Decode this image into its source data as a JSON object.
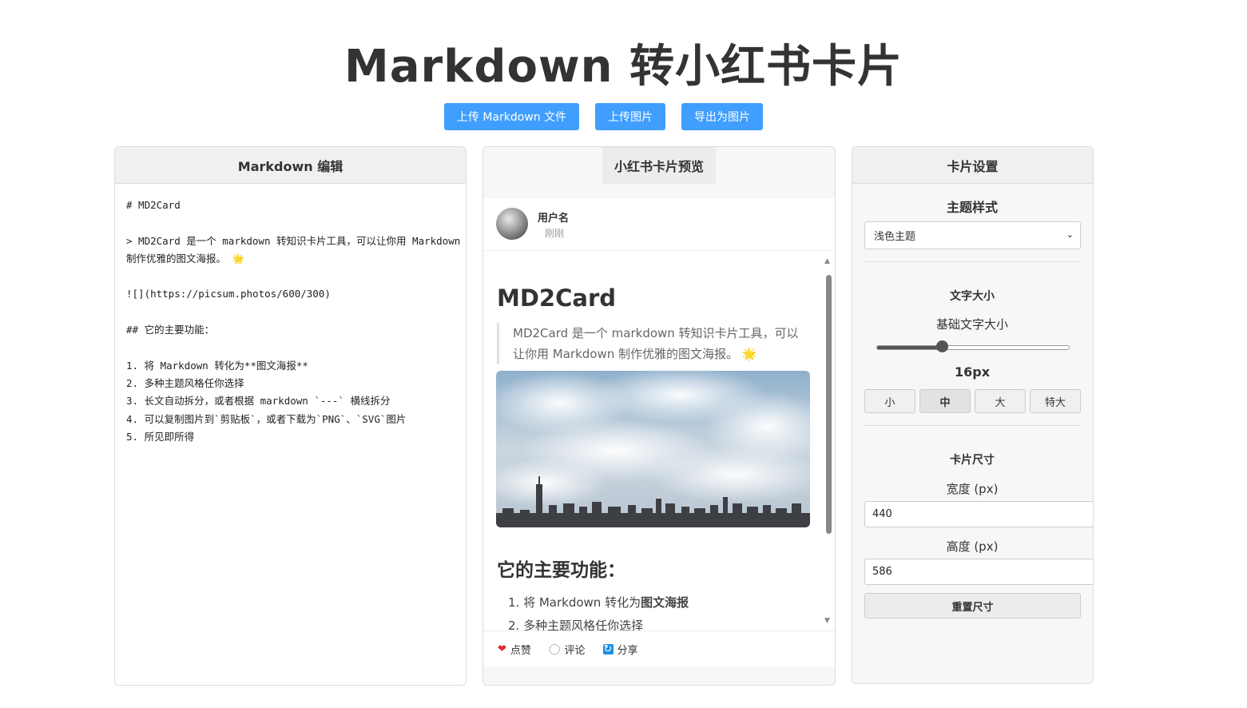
{
  "title": "Markdown 转小红书卡片",
  "toolbar": {
    "upload_md": "上传 Markdown 文件",
    "upload_img": "上传图片",
    "export_img": "导出为图片"
  },
  "editor": {
    "header": "Markdown 编辑",
    "lines": [
      "# MD2Card",
      "",
      "> MD2Card 是一个 markdown 转知识卡片工具，可以让你用 Markdown",
      "制作优雅的图文海报。 🌟",
      "",
      "![](https://picsum.photos/600/300)",
      "",
      "## 它的主要功能：",
      "",
      "1. 将 Markdown 转化为**图文海报**",
      "2. 多种主题风格任你选择",
      "3. 长文自动拆分，或者根据 markdown `---` 横线拆分",
      "4. 可以复制图片到`剪贴板`，或者下载为`PNG`、`SVG`图片",
      "5. 所见即所得"
    ]
  },
  "preview": {
    "header": "小红书卡片预览",
    "username": "用户名",
    "time": "刚刚",
    "h1": "MD2Card",
    "quote": "MD2Card 是一个 markdown 转知识卡片工具，可以让你用 Markdown 制作优雅的图文海报。",
    "quote_emoji": "🌟",
    "h2": "它的主要功能：",
    "li1_prefix": "1. 将 Markdown 转化为",
    "li1_bold": "图文海报",
    "li2": "2. 多种主题风格任你选择",
    "actions": {
      "like": "点赞",
      "comment": "评论",
      "share": "分享"
    },
    "icons": {
      "like": "heart-icon",
      "comment": "comment-icon",
      "share": "share-icon"
    }
  },
  "settings": {
    "header": "卡片设置",
    "theme_title": "主题样式",
    "theme_value": "浅色主题",
    "text_size_title": "文字大小",
    "base_size_label": "基础文字大小",
    "base_size_value": "16px",
    "slider_fraction": 0.34,
    "size_buttons": [
      "小",
      "中",
      "大",
      "特大"
    ],
    "active_size": "中",
    "card_size_title": "卡片尺寸",
    "width_label": "宽度 (px)",
    "width_value": "440",
    "height_label": "高度 (px)",
    "height_value": "586",
    "reset": "重置尺寸"
  },
  "colors": {
    "primary": "#409eff",
    "heart": "#e02828"
  }
}
